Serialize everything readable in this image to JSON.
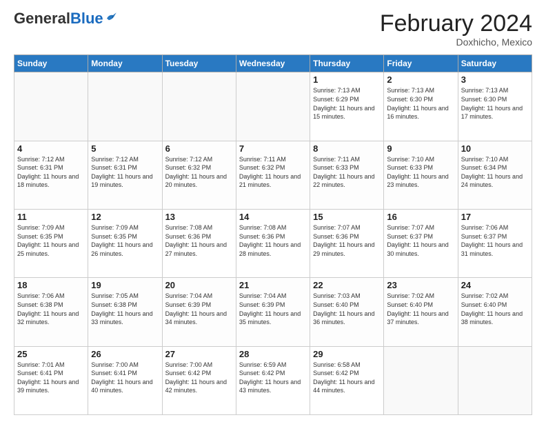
{
  "logo": {
    "general": "General",
    "blue": "Blue"
  },
  "header": {
    "month_year": "February 2024",
    "location": "Doxhicho, Mexico"
  },
  "weekdays": [
    "Sunday",
    "Monday",
    "Tuesday",
    "Wednesday",
    "Thursday",
    "Friday",
    "Saturday"
  ],
  "weeks": [
    [
      {
        "day": "",
        "info": ""
      },
      {
        "day": "",
        "info": ""
      },
      {
        "day": "",
        "info": ""
      },
      {
        "day": "",
        "info": ""
      },
      {
        "day": "1",
        "info": "Sunrise: 7:13 AM\nSunset: 6:29 PM\nDaylight: 11 hours and 15 minutes."
      },
      {
        "day": "2",
        "info": "Sunrise: 7:13 AM\nSunset: 6:30 PM\nDaylight: 11 hours and 16 minutes."
      },
      {
        "day": "3",
        "info": "Sunrise: 7:13 AM\nSunset: 6:30 PM\nDaylight: 11 hours and 17 minutes."
      }
    ],
    [
      {
        "day": "4",
        "info": "Sunrise: 7:12 AM\nSunset: 6:31 PM\nDaylight: 11 hours and 18 minutes."
      },
      {
        "day": "5",
        "info": "Sunrise: 7:12 AM\nSunset: 6:31 PM\nDaylight: 11 hours and 19 minutes."
      },
      {
        "day": "6",
        "info": "Sunrise: 7:12 AM\nSunset: 6:32 PM\nDaylight: 11 hours and 20 minutes."
      },
      {
        "day": "7",
        "info": "Sunrise: 7:11 AM\nSunset: 6:32 PM\nDaylight: 11 hours and 21 minutes."
      },
      {
        "day": "8",
        "info": "Sunrise: 7:11 AM\nSunset: 6:33 PM\nDaylight: 11 hours and 22 minutes."
      },
      {
        "day": "9",
        "info": "Sunrise: 7:10 AM\nSunset: 6:33 PM\nDaylight: 11 hours and 23 minutes."
      },
      {
        "day": "10",
        "info": "Sunrise: 7:10 AM\nSunset: 6:34 PM\nDaylight: 11 hours and 24 minutes."
      }
    ],
    [
      {
        "day": "11",
        "info": "Sunrise: 7:09 AM\nSunset: 6:35 PM\nDaylight: 11 hours and 25 minutes."
      },
      {
        "day": "12",
        "info": "Sunrise: 7:09 AM\nSunset: 6:35 PM\nDaylight: 11 hours and 26 minutes."
      },
      {
        "day": "13",
        "info": "Sunrise: 7:08 AM\nSunset: 6:36 PM\nDaylight: 11 hours and 27 minutes."
      },
      {
        "day": "14",
        "info": "Sunrise: 7:08 AM\nSunset: 6:36 PM\nDaylight: 11 hours and 28 minutes."
      },
      {
        "day": "15",
        "info": "Sunrise: 7:07 AM\nSunset: 6:36 PM\nDaylight: 11 hours and 29 minutes."
      },
      {
        "day": "16",
        "info": "Sunrise: 7:07 AM\nSunset: 6:37 PM\nDaylight: 11 hours and 30 minutes."
      },
      {
        "day": "17",
        "info": "Sunrise: 7:06 AM\nSunset: 6:37 PM\nDaylight: 11 hours and 31 minutes."
      }
    ],
    [
      {
        "day": "18",
        "info": "Sunrise: 7:06 AM\nSunset: 6:38 PM\nDaylight: 11 hours and 32 minutes."
      },
      {
        "day": "19",
        "info": "Sunrise: 7:05 AM\nSunset: 6:38 PM\nDaylight: 11 hours and 33 minutes."
      },
      {
        "day": "20",
        "info": "Sunrise: 7:04 AM\nSunset: 6:39 PM\nDaylight: 11 hours and 34 minutes."
      },
      {
        "day": "21",
        "info": "Sunrise: 7:04 AM\nSunset: 6:39 PM\nDaylight: 11 hours and 35 minutes."
      },
      {
        "day": "22",
        "info": "Sunrise: 7:03 AM\nSunset: 6:40 PM\nDaylight: 11 hours and 36 minutes."
      },
      {
        "day": "23",
        "info": "Sunrise: 7:02 AM\nSunset: 6:40 PM\nDaylight: 11 hours and 37 minutes."
      },
      {
        "day": "24",
        "info": "Sunrise: 7:02 AM\nSunset: 6:40 PM\nDaylight: 11 hours and 38 minutes."
      }
    ],
    [
      {
        "day": "25",
        "info": "Sunrise: 7:01 AM\nSunset: 6:41 PM\nDaylight: 11 hours and 39 minutes."
      },
      {
        "day": "26",
        "info": "Sunrise: 7:00 AM\nSunset: 6:41 PM\nDaylight: 11 hours and 40 minutes."
      },
      {
        "day": "27",
        "info": "Sunrise: 7:00 AM\nSunset: 6:42 PM\nDaylight: 11 hours and 42 minutes."
      },
      {
        "day": "28",
        "info": "Sunrise: 6:59 AM\nSunset: 6:42 PM\nDaylight: 11 hours and 43 minutes."
      },
      {
        "day": "29",
        "info": "Sunrise: 6:58 AM\nSunset: 6:42 PM\nDaylight: 11 hours and 44 minutes."
      },
      {
        "day": "",
        "info": ""
      },
      {
        "day": "",
        "info": ""
      }
    ]
  ]
}
